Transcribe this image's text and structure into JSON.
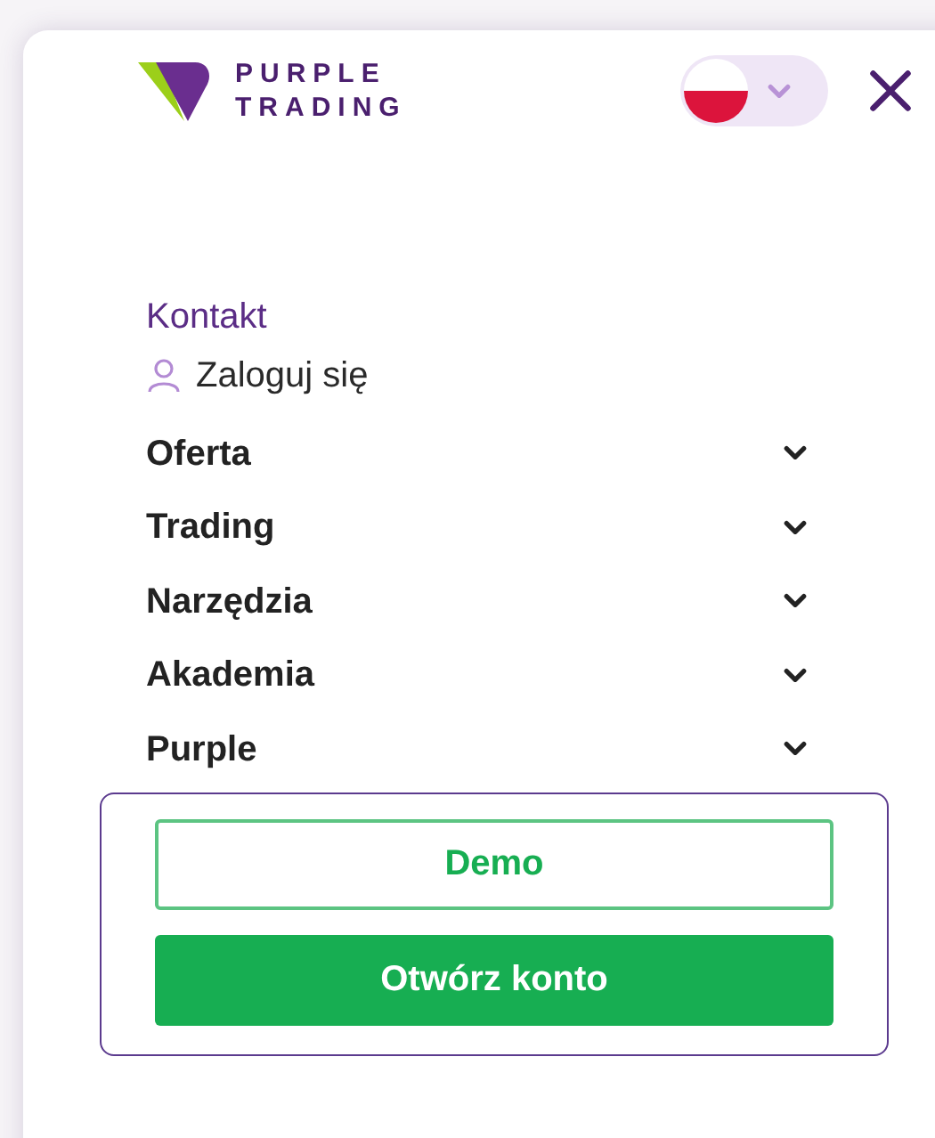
{
  "logo": {
    "lines": [
      "PURPLE",
      "TRADING"
    ]
  },
  "language": {
    "expanded": false
  },
  "links": [
    {
      "kind": "contact",
      "label": "Kontakt"
    },
    {
      "kind": "login",
      "label": "Zaloguj się"
    }
  ],
  "menu": [
    {
      "label": "Oferta",
      "expanded": false
    },
    {
      "label": "Trading",
      "expanded": false
    },
    {
      "label": "Narzędzia",
      "expanded": false
    },
    {
      "label": "Akademia",
      "expanded": false
    },
    {
      "label": "Purple",
      "expanded": false
    }
  ],
  "buttons": [
    {
      "kind": "outline",
      "label": "Demo"
    },
    {
      "kind": "primary",
      "label": "Otwórz konto"
    }
  ]
}
